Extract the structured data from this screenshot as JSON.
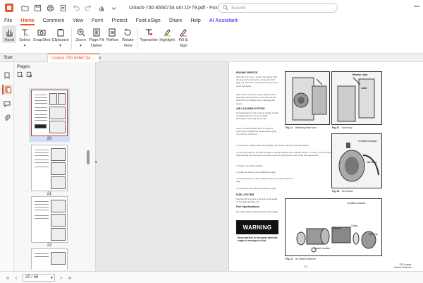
{
  "titlebar": {
    "title": "Unlock-730 6556734 om 10-79.pdf - Foxit PDF Reader",
    "search_placeholder": "Search"
  },
  "menu": {
    "items": [
      {
        "label": "File"
      },
      {
        "label": "Home"
      },
      {
        "label": "Comment"
      },
      {
        "label": "View"
      },
      {
        "label": "Form"
      },
      {
        "label": "Protect"
      },
      {
        "label": "Foxit eSign"
      },
      {
        "label": "Share"
      },
      {
        "label": "Help"
      },
      {
        "label": "AI Assistant"
      }
    ],
    "active": "Home"
  },
  "ribbon": {
    "hand": "Hand",
    "select": "Select",
    "snapshot": "SnapShot",
    "clipboard": "Clipboard",
    "zoom": "Zoom",
    "page_fit_1": "Page Fit",
    "page_fit_2": "Option",
    "reflow": "Reflow",
    "rotate_1": "Rotate",
    "rotate_2": "View",
    "typewriter": "Typewriter",
    "highlight": "Highlight",
    "fill_sign_1": "Fill &",
    "fill_sign_2": "Sign"
  },
  "tabs": {
    "start": "Start",
    "doc": "Unlock-730 6556734 ...",
    "close": "✕"
  },
  "pages_panel": {
    "title": "Pages",
    "thumbs": [
      {
        "num": "20"
      },
      {
        "num": "21"
      },
      {
        "num": "22"
      }
    ]
  },
  "document": {
    "engine_service_head": "ENGINE SERVICE",
    "engine_service_text": "Open the rear door to service the engine. Pull the door latch to the left to release the latch (Fig. 21). The door can then be fully opened to reach the engine.",
    "push_text": "Push down on the door stop to hold the door open (Fig. 22). Be sure to close the door and fasten the latch tightly before operating the loader.",
    "air_head": "AIR CLEANER SYSTEM",
    "air_text": "It is important to service the air cleaner system at regular intervals for good engine performance and long service life.",
    "element_text": "The air cleaner element must be replaced when the red ring shows in the window (Fig. 23). Service as follows:",
    "steps": [
      "1. Loosen the clamp on the dust cup (Fig. 24). Remove the dust cup and element.",
      "2. Clean the inside of the filter housing so that the element has a smooth surface to contact at the seal (Fig. 24, Item 1). Check the filter housing for leaks from corrosion, especially if the filter is used in the dust application.",
      "3. Install a new filter element.",
      "4. Install the dust cup and tighten the clamp.",
      "5. Push the button on the condition indicator to remove the red ring.",
      "6. Check that the hoses and clamps are tight."
    ],
    "fuel_head": "FUEL SYSTEM",
    "fuel_text": "The fuel fill is located at the rear of the loader on the right side (Fig. 25).",
    "fuel_spec_head": "Fuel Specifications",
    "fuel_spec_text": "Use only regular leaded gasoline in the engine.",
    "warning": "WARNING",
    "warning_text": "Never add fuel to the loader when the engine is running or is hot.",
    "fig21": "Fig. 21",
    "fig21_cap": "Releasing Rear Door",
    "fig22": "Fig. 22",
    "fig22_cap": "Door Stop",
    "fig23": "Fig. 23",
    "fig23_cap": "Air Cleaner",
    "fig24": "Fig. 24",
    "fig24_cap": "Air Cleaner Element",
    "label_release": "Release Latch",
    "label_latch": "Latch",
    "label_indicator": "Condition Indicator",
    "label_air_filter": "Air Filter",
    "label_element": "Element",
    "label_clamp": "Clamp",
    "label_dust_cup": "Dust Cup",
    "label_gasket": "Gasket Location",
    "label_cond_ind": "Condition Indicator",
    "page_footer": "- 13 -",
    "footer_model": "730 Loader",
    "footer_manual": "Owner's Manual"
  },
  "statusbar": {
    "page_value": "20 / 56"
  }
}
